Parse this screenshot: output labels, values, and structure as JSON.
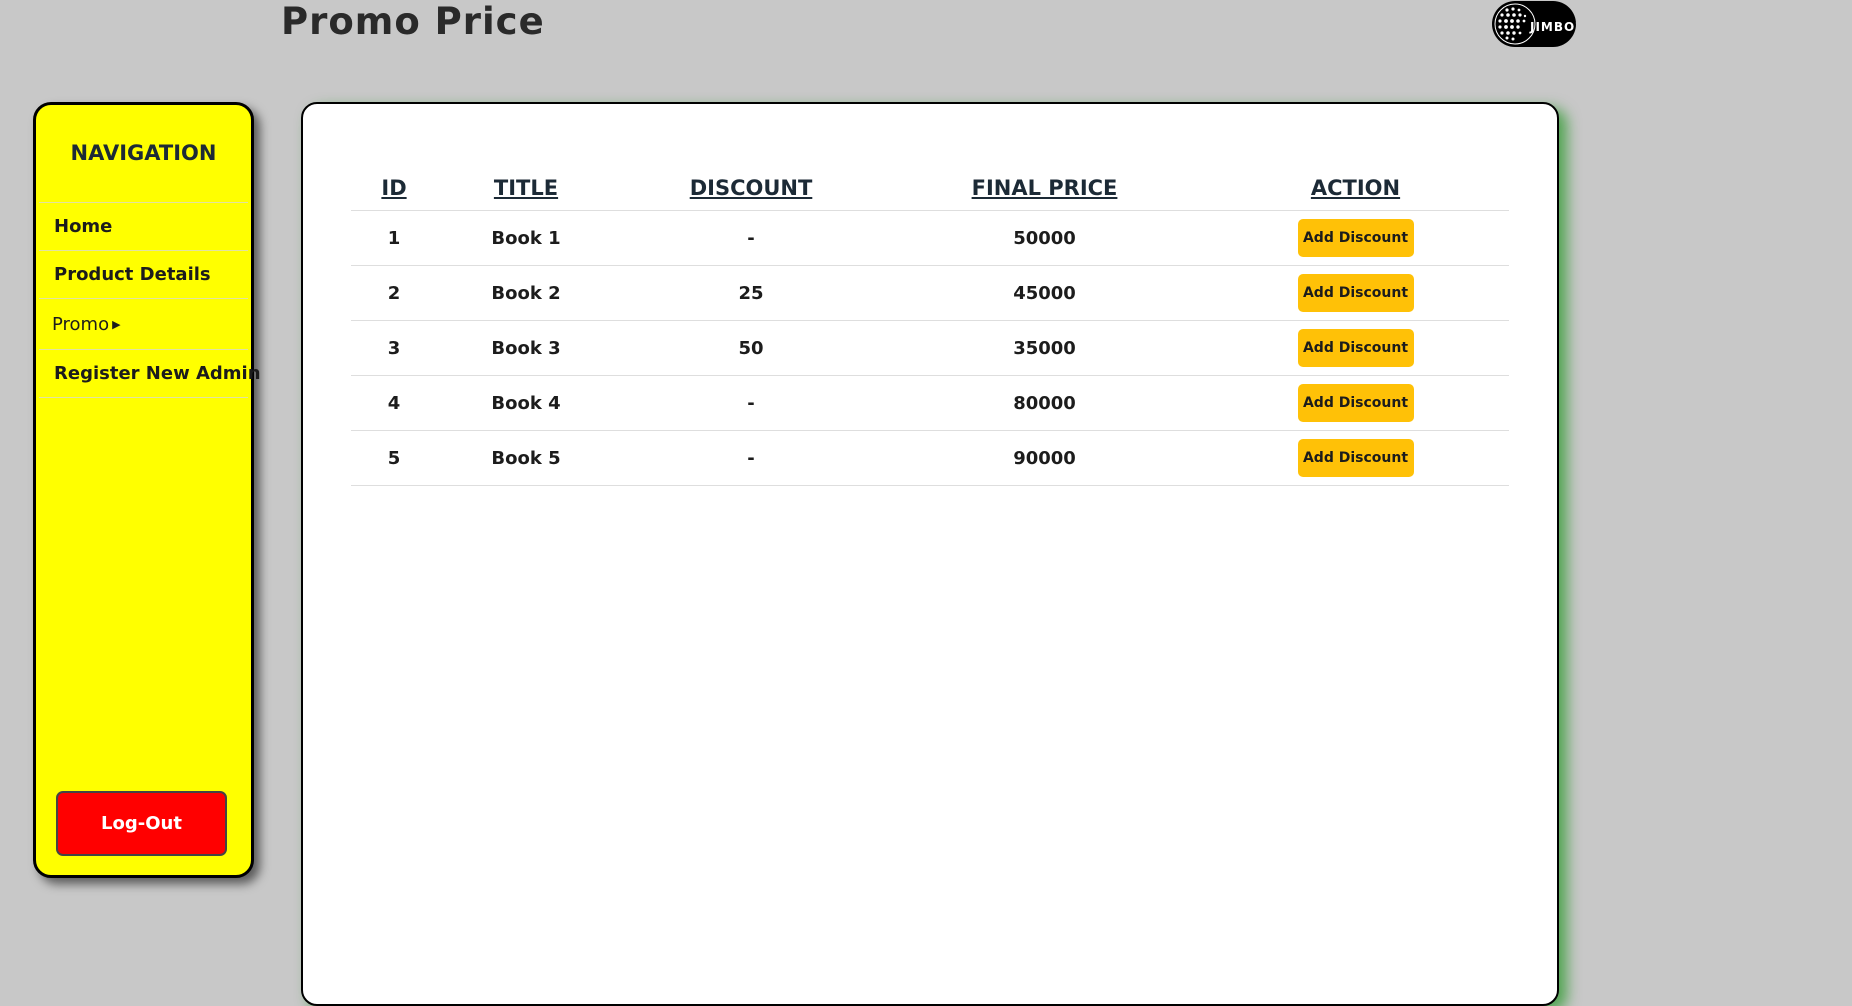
{
  "header": {
    "title": "Promo Price",
    "logo_text": "JIMBOZ"
  },
  "sidebar": {
    "title": "NAVIGATION",
    "items": [
      {
        "label": "Home"
      },
      {
        "label": "Product Details"
      },
      {
        "label": "Promo",
        "has_submenu": true
      },
      {
        "label": "Register New Admin"
      }
    ],
    "logout_label": "Log-Out"
  },
  "table": {
    "columns": [
      "ID",
      "TITLE",
      "DISCOUNT",
      "FINAL PRICE",
      "ACTION"
    ],
    "rows": [
      {
        "id": "1",
        "title": "Book 1",
        "discount": "-",
        "final_price": "50000",
        "action": "Add Discount"
      },
      {
        "id": "2",
        "title": "Book 2",
        "discount": "25",
        "final_price": "45000",
        "action": "Add Discount"
      },
      {
        "id": "3",
        "title": "Book 3",
        "discount": "50",
        "final_price": "35000",
        "action": "Add Discount"
      },
      {
        "id": "4",
        "title": "Book 4",
        "discount": "-",
        "final_price": "80000",
        "action": "Add Discount"
      },
      {
        "id": "5",
        "title": "Book 5",
        "discount": "-",
        "final_price": "90000",
        "action": "Add Discount"
      }
    ]
  },
  "colors": {
    "background": "#c8c8c8",
    "sidebar": "#ffff00",
    "logout": "#ff0000",
    "action_button": "#ffc107",
    "card_glow": "#008c00"
  },
  "icons": {
    "logo": "globe-icon",
    "promo_arrow": "caret-right-icon"
  }
}
